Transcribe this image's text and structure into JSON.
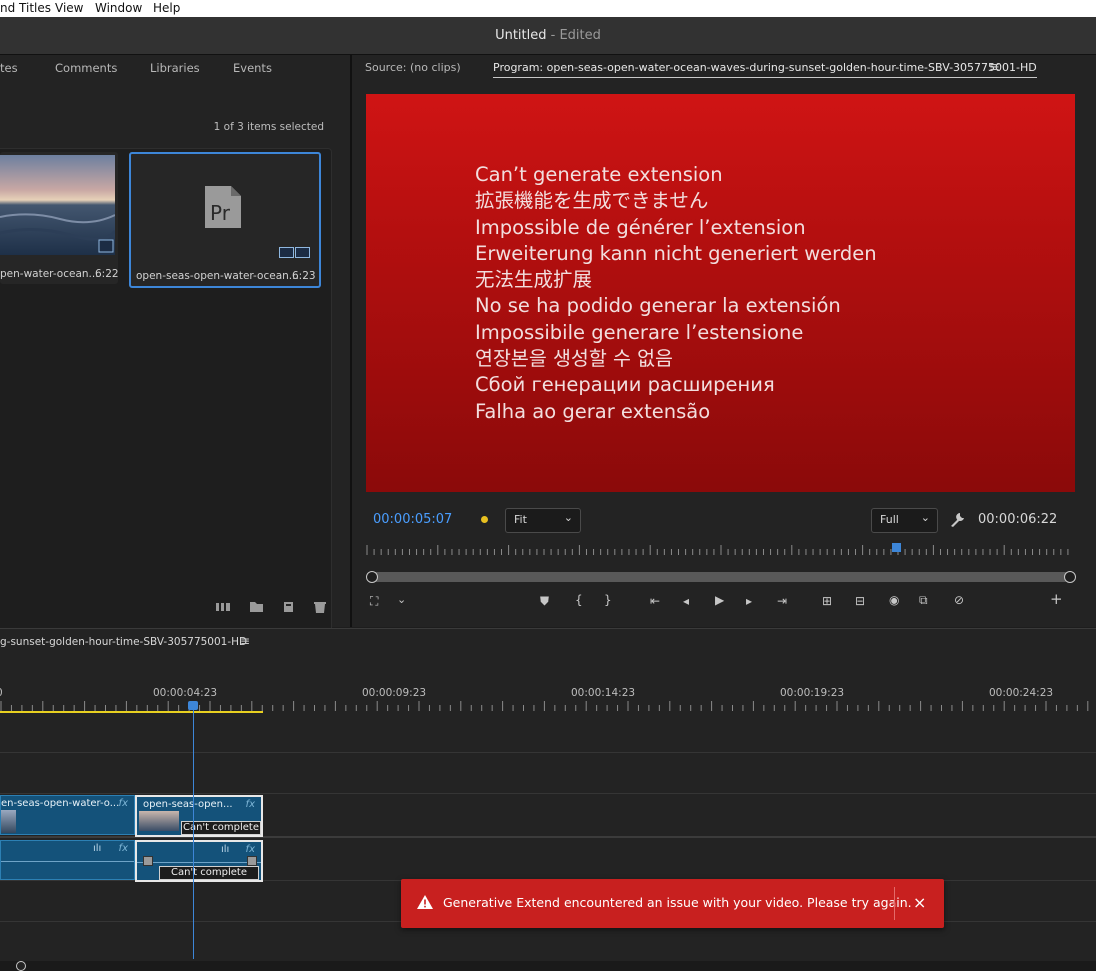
{
  "menu": [
    "nd Titles",
    "View",
    "Window",
    "Help"
  ],
  "window": {
    "title": "Untitled",
    "status": " - Edited"
  },
  "project": {
    "tabs": [
      "tes",
      "Comments",
      "Libraries",
      "Events"
    ],
    "selection_status": "1 of 3 items selected",
    "items": [
      {
        "name": "pen-water-ocean...",
        "duration": "6:22"
      },
      {
        "name": "open-seas-open-water-ocean...",
        "duration": "6:23",
        "icon": "premiere-file-icon"
      }
    ]
  },
  "monitor": {
    "source_tab": "Source: (no clips)",
    "program_tab": "Program: open-seas-open-water-ocean-waves-during-sunset-golden-hour-time-SBV-305775001-HD",
    "message_lines": [
      "Can’t generate extension",
      "拡張機能を生成できません",
      "Impossible de générer l’extension",
      "Erweiterung kann nicht generiert werden",
      "无法生成扩展",
      "No se ha podido generar la extensión",
      "Impossibile generare l’estensione",
      "연장본을 생성할 수 없음",
      "Сбой генерации расширения",
      "Falha ao gerar extensão"
    ],
    "current_time": "00:00:05:07",
    "zoom": "Fit",
    "quality": "Full",
    "duration": "00:00:06:22",
    "playhead_fraction": 0.75
  },
  "timeline": {
    "sequence_name": "g-sunset-golden-hour-time-SBV-305775001-HD",
    "ruler": [
      "0",
      "00:00:04:23",
      "00:00:09:23",
      "00:00:14:23",
      "00:00:19:23",
      "00:00:24:23"
    ],
    "video_clips": [
      {
        "name": "en-seas-open-water-o...",
        "fx": "fx"
      },
      {
        "name": "open-seas-open...",
        "fx": "fx",
        "status": "Can't complete"
      }
    ],
    "audio_clips": [
      {
        "fx": "fx"
      },
      {
        "fx": "fx",
        "status": "Can't complete"
      }
    ]
  },
  "toast": {
    "message": "Generative Extend encountered an issue with your video. Please try again.",
    "close": "×",
    "color": "#c8201f"
  },
  "colors": {
    "accent": "#3d86d8",
    "timecode": "#4a9eff",
    "clip": "#14527a"
  }
}
